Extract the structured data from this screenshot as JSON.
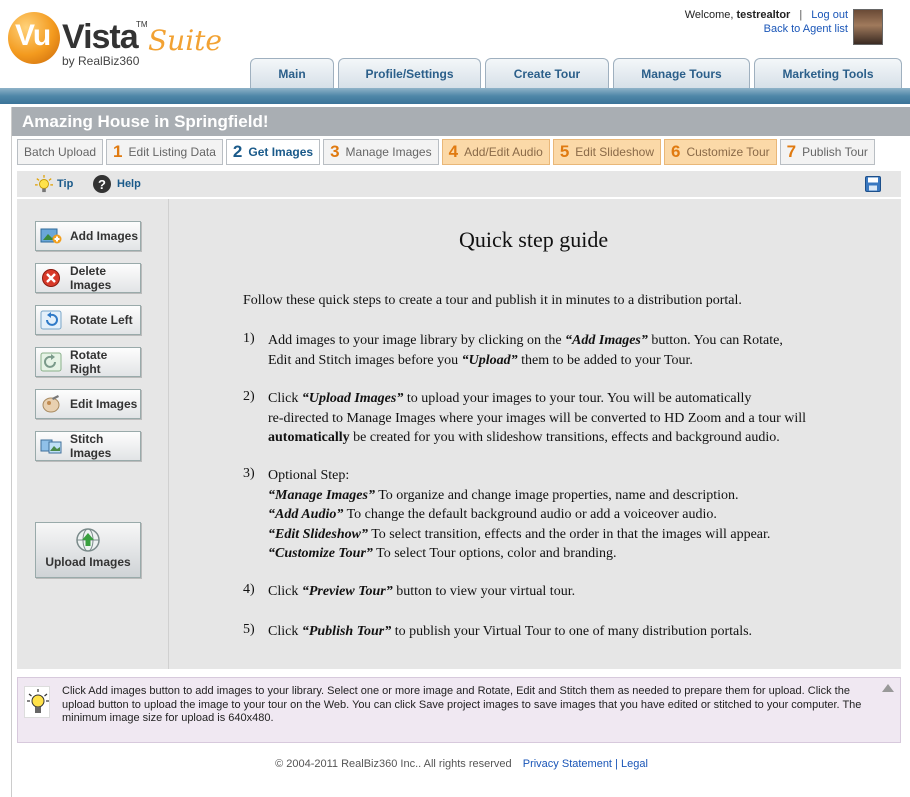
{
  "header": {
    "logo": {
      "vu": "Vu",
      "vista": "Vista",
      "tm": "TM",
      "suite": "Suite",
      "by": "by RealBiz360"
    },
    "welcome_prefix": "Welcome,",
    "username": "testrealtor",
    "logout": "Log out",
    "back_link": "Back to Agent list"
  },
  "nav": {
    "tabs": [
      "Main",
      "Profile/Settings",
      "Create Tour",
      "Manage Tours",
      "Marketing Tools"
    ]
  },
  "page_title": "Amazing House in Springfield!",
  "steps": [
    {
      "num": "",
      "label": "Batch Upload",
      "state": "normal"
    },
    {
      "num": "1",
      "label": "Edit Listing Data",
      "state": "normal"
    },
    {
      "num": "2",
      "label": "Get Images",
      "state": "active"
    },
    {
      "num": "3",
      "label": "Manage Images",
      "state": "normal"
    },
    {
      "num": "4",
      "label": "Add/Edit Audio",
      "state": "orange"
    },
    {
      "num": "5",
      "label": "Edit Slideshow",
      "state": "orange"
    },
    {
      "num": "6",
      "label": "Customize Tour",
      "state": "orange"
    },
    {
      "num": "7",
      "label": "Publish Tour",
      "state": "normal"
    }
  ],
  "toolbar": {
    "tip": "Tip",
    "help": "Help"
  },
  "side_buttons": {
    "add": "Add Images",
    "delete": "Delete Images",
    "rotate_left": "Rotate Left",
    "rotate_right": "Rotate Right",
    "edit": "Edit Images",
    "stitch": "Stitch Images",
    "upload": "Upload Images"
  },
  "guide": {
    "title": "Quick step guide",
    "intro": "Follow these quick steps to create a tour and publish it in minutes to a distribution portal.",
    "s1": {
      "n": "1)",
      "a": "Add images to your image library by clicking on the ",
      "b": "“Add Images”",
      "c": " button. You can Rotate,",
      "d": "Edit and Stitch images before you ",
      "e": "“Upload”",
      "f": " them to be added to your Tour."
    },
    "s2": {
      "n": "2)",
      "a": "Click ",
      "b": "“Upload Images”",
      "c": " to upload your images to your tour. You will be automatically",
      "d": "re-directed to Manage Images where your images will be converted to HD Zoom and a tour will",
      "e": "automatically",
      "f": " be created for you with slideshow transitions, effects and background audio."
    },
    "s3": {
      "n": "3)",
      "a": "Optional Step:",
      "b1": "“Manage Images”",
      "c1": " To organize and change image properties, name and description.",
      "b2": "“Add Audio”",
      "c2": " To change the default background audio or add a voiceover audio.",
      "b3": "“Edit Slideshow”",
      "c3": " To select transition, effects and the order in that the images will appear.",
      "b4": "“Customize Tour”",
      "c4": " To select Tour options, color and branding."
    },
    "s4": {
      "n": "4)",
      "a": "Click ",
      "b": "“Preview Tour”",
      "c": " button to view your virtual tour."
    },
    "s5": {
      "n": "5)",
      "a": "Click ",
      "b": "“Publish Tour”",
      "c": " to publish your Virtual Tour to one of many distribution portals."
    }
  },
  "info": "Click Add images button to add images to your library. Select one or more image and Rotate, Edit and Stitch them as needed to prepare them for upload. Click the upload button to upload the image to your tour on the Web. You can click Save project images to save images that you have edited or stitched to your computer. The minimum image size for upload is 640x480.",
  "footer": {
    "copyright": "© 2004-2011 RealBiz360 Inc.. All rights reserved",
    "privacy": "Privacy Statement",
    "sep": "|",
    "legal": "Legal"
  },
  "colors": {
    "accent_blue": "#1a5a8a",
    "step_orange": "#e07a10",
    "nav_bar": "#4f87a8",
    "title_bar": "#a9aeb3"
  }
}
